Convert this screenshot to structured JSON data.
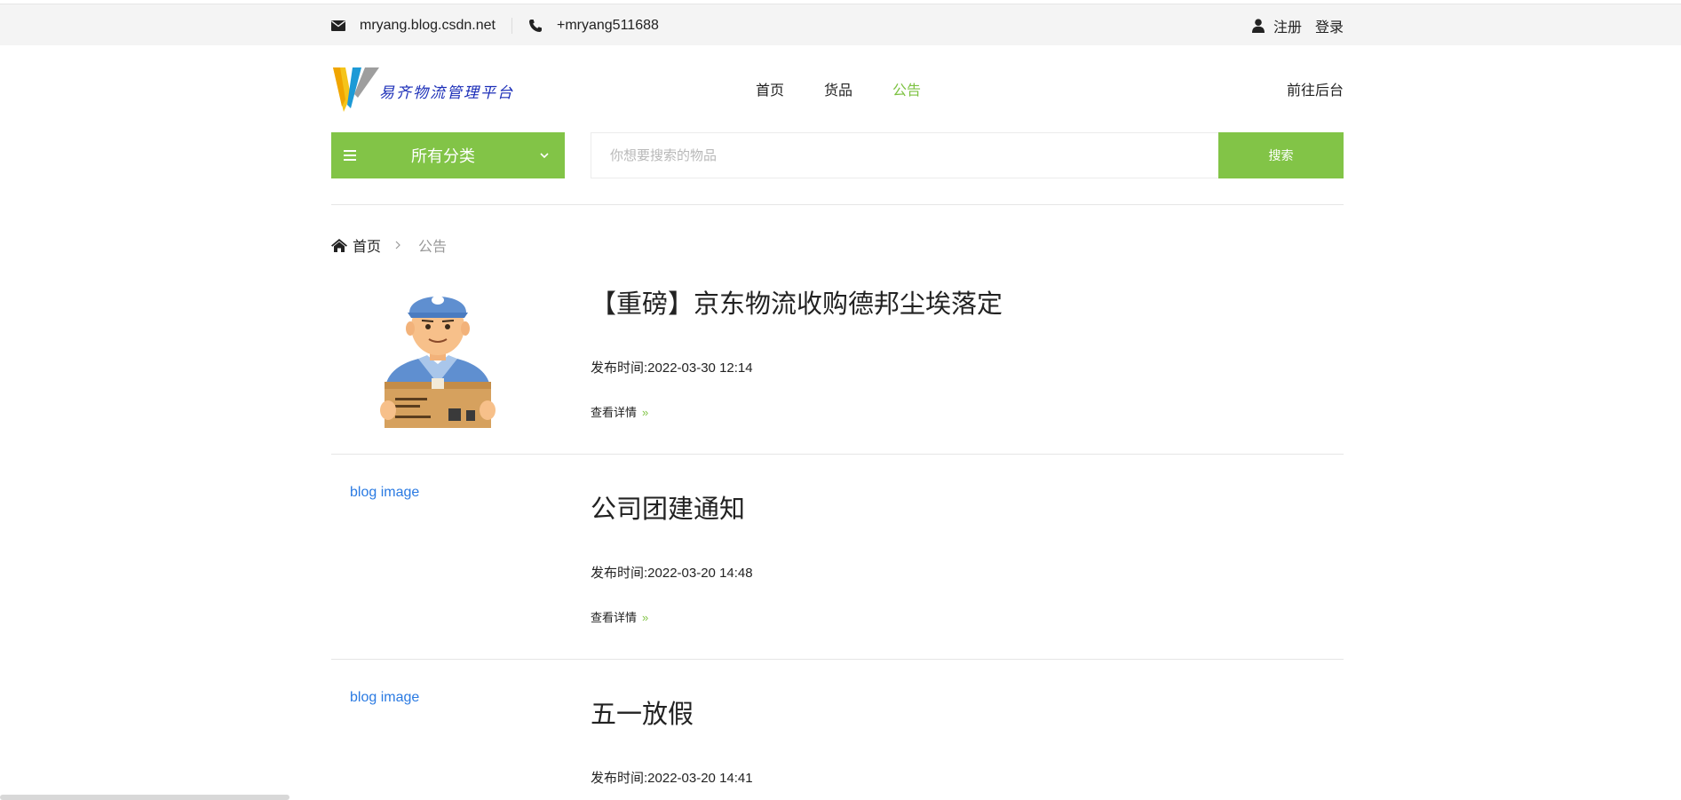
{
  "topbar": {
    "email": "mryang.blog.csdn.net",
    "phone": "+mryang511688",
    "register": "注册",
    "login": "登录"
  },
  "header": {
    "logo_text": "易齐物流管理平台",
    "nav": [
      {
        "label": "首页"
      },
      {
        "label": "货品"
      },
      {
        "label": "公告",
        "active": true
      }
    ],
    "admin_link": "前往后台"
  },
  "category_button": {
    "label": "所有分类"
  },
  "search": {
    "placeholder": "你想要搜索的物品",
    "button": "搜索"
  },
  "breadcrumb": {
    "home": "首页",
    "current": "公告"
  },
  "posts": [
    {
      "title": "【重磅】京东物流收购德邦尘埃落定",
      "date": "发布时间:2022-03-30 12:14",
      "more": "查看详情",
      "image_alt": ""
    },
    {
      "title": "公司团建通知",
      "date": "发布时间:2022-03-20 14:48",
      "more": "查看详情",
      "image_alt": "blog image"
    },
    {
      "title": "五一放假",
      "date": "发布时间:2022-03-20 14:41",
      "more": "查看详情",
      "image_alt": "blog image"
    }
  ],
  "colors": {
    "accent": "#82c447",
    "link": "#2a7ae2",
    "topbar_bg": "#f4f4f4"
  },
  "icons": [
    "envelope-icon",
    "phone-icon",
    "user-icon",
    "menu-icon",
    "chevron-down-icon",
    "home-icon",
    "chevron-right-icon",
    "broken-image-icon"
  ]
}
